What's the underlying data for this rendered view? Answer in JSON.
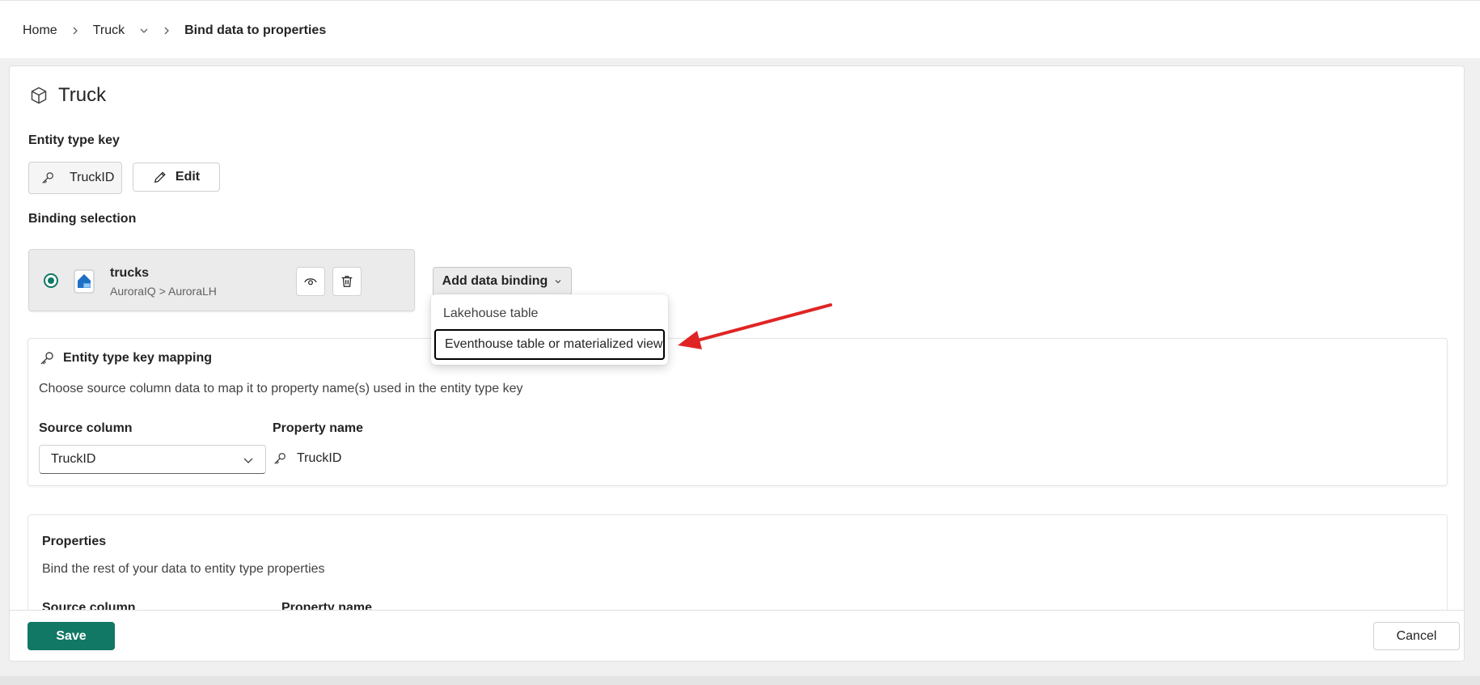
{
  "breadcrumb": {
    "home": "Home",
    "entity": "Truck",
    "current": "Bind data to properties"
  },
  "page": {
    "title": "Truck",
    "title_icon": "cube-icon"
  },
  "entity_type_key": {
    "label": "Entity type key",
    "key_chip": "TruckID",
    "edit_label": "Edit"
  },
  "binding_selection": {
    "label": "Binding selection",
    "binding": {
      "name": "trucks",
      "path": "AuroraIQ > AuroraLH",
      "selected": true
    },
    "add_button_label": "Add data binding"
  },
  "dropdown_menu": {
    "items": [
      {
        "label": "Lakehouse table"
      },
      {
        "label": "Eventhouse table or materialized view"
      }
    ],
    "focused_index": 1
  },
  "key_mapping": {
    "title": "Entity type key mapping",
    "description": "Choose source column data to map it to property name(s) used in the entity type key",
    "source_column_header": "Source column",
    "property_name_header": "Property name",
    "source_value": "TruckID",
    "property_value": "TruckID"
  },
  "properties": {
    "title": "Properties",
    "description": "Bind the rest of your data to entity type properties",
    "source_column_header": "Source column",
    "property_name_header": "Property name"
  },
  "footer": {
    "save_label": "Save",
    "cancel_label": "Cancel"
  },
  "colors": {
    "accent": "#117865",
    "annotation": "#e02424"
  }
}
